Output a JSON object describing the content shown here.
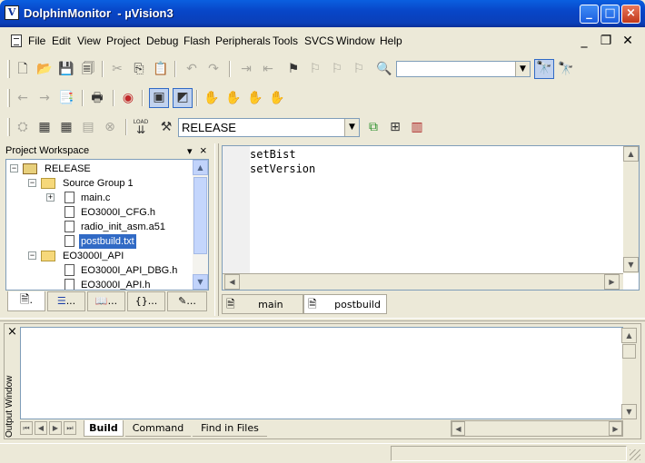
{
  "window": {
    "title": "DolphinMonitor  - µVision3",
    "minimize_glyph": "_",
    "maximize_glyph": "□",
    "close_glyph": "×"
  },
  "menu": {
    "items": [
      "File",
      "Edit",
      "View",
      "Project",
      "Debug",
      "Flash",
      "Peripherals",
      "Tools",
      "SVCS",
      "Window",
      "Help"
    ],
    "mdi_minimize": "_",
    "mdi_restore": "❐",
    "mdi_close": "✕"
  },
  "toolbar": {
    "find_combo_value": "",
    "target_combo_value": "RELEASE",
    "load_label": "LOAD"
  },
  "project_workspace": {
    "title": "Project Workspace",
    "pin_glyph": "▾",
    "close_glyph": "×",
    "tree": [
      {
        "label": "RELEASE",
        "level": 0,
        "kind": "target",
        "expander": "−"
      },
      {
        "label": "Source Group 1",
        "level": 1,
        "kind": "folder",
        "expander": "−"
      },
      {
        "label": "main.c",
        "level": 2,
        "kind": "file",
        "expander": "+"
      },
      {
        "label": "EO3000I_CFG.h",
        "level": 2,
        "kind": "file",
        "expander": ""
      },
      {
        "label": "radio_init_asm.a51",
        "level": 2,
        "kind": "file",
        "expander": ""
      },
      {
        "label": "postbuild.txt",
        "level": 2,
        "kind": "file",
        "expander": "",
        "selected": true
      },
      {
        "label": "EO3000I_API",
        "level": 1,
        "kind": "folder",
        "expander": "−"
      },
      {
        "label": "EO3000I_API_DBG.h",
        "level": 2,
        "kind": "file",
        "expander": ""
      },
      {
        "label": "EO3000I_API.h",
        "level": 2,
        "kind": "file",
        "expander": ""
      }
    ],
    "tabs": [
      ".",
      "...",
      "...",
      "{}...",
      "..."
    ]
  },
  "editor": {
    "lines": [
      "setBist",
      "setVersion"
    ],
    "tabs": [
      {
        "label": "main",
        "active": false
      },
      {
        "label": "postbuild",
        "active": true
      }
    ]
  },
  "output": {
    "title": "Output Window",
    "close_glyph": "×",
    "tabs": [
      {
        "label": "Build",
        "active": true
      },
      {
        "label": "Command",
        "active": false
      },
      {
        "label": "Find in Files",
        "active": false
      }
    ]
  },
  "colors": {
    "titlebar": "#0a3fb8",
    "selection": "#316ac5",
    "face": "#ece9d8"
  }
}
